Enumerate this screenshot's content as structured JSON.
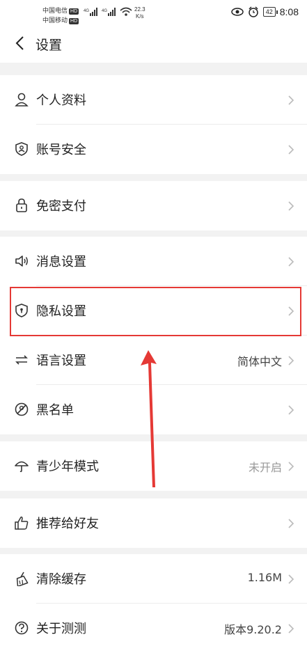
{
  "status_bar": {
    "carrier1": "中国电信",
    "carrier2": "中国移动",
    "hd": "HD",
    "net1": "4G",
    "net2": "4G",
    "speed_value": "22.3",
    "speed_unit": "K/s",
    "battery": "42",
    "time": "8:08"
  },
  "header": {
    "title": "设置"
  },
  "groups": [
    {
      "items": [
        {
          "label": "个人资料",
          "icon": "person-icon"
        },
        {
          "label": "账号安全",
          "icon": "shield-account-icon"
        }
      ]
    },
    {
      "items": [
        {
          "label": "免密支付",
          "icon": "lock-icon"
        }
      ]
    },
    {
      "items": [
        {
          "label": "消息设置",
          "icon": "speaker-icon"
        },
        {
          "label": "隐私设置",
          "icon": "privacy-shield-icon"
        },
        {
          "label": "语言设置",
          "icon": "swap-icon",
          "value": "简体中文"
        },
        {
          "label": "黑名单",
          "icon": "block-icon"
        }
      ]
    },
    {
      "items": [
        {
          "label": "青少年模式",
          "icon": "umbrella-icon",
          "value": "未开启"
        }
      ]
    },
    {
      "items": [
        {
          "label": "推荐给好友",
          "icon": "thumbs-up-icon"
        }
      ]
    },
    {
      "items": [
        {
          "label": "清除缓存",
          "icon": "broom-icon",
          "value": "1.16M"
        },
        {
          "label": "关于测测",
          "icon": "question-icon",
          "value": "版本9.20.2"
        }
      ]
    }
  ],
  "colors": {
    "highlight": "#e53935",
    "arrow": "#e53935"
  }
}
